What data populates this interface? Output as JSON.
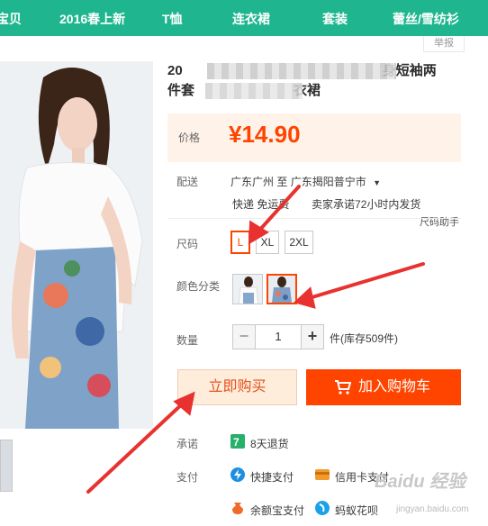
{
  "nav": {
    "items": [
      "宝贝",
      "2016春上新",
      "T恤",
      "连衣裙",
      "套装",
      "蕾丝/雪纺衫"
    ]
  },
  "report": "举报",
  "product": {
    "title_line1_start": "20",
    "title_line1_end": "身短袖两",
    "title_line2_start": "件套",
    "title_line2_end": "衣裙"
  },
  "price": {
    "label": "价格",
    "value": "¥14.90"
  },
  "shipping": {
    "label": "配送",
    "from": "广东广州",
    "to_word": "至",
    "to": "广东揭阳普宁市",
    "express": "快递 免运费",
    "promise": "卖家承诺72小时内发货"
  },
  "size": {
    "label": "尺码",
    "help": "尺码助手",
    "options": [
      "L",
      "XL",
      "2XL"
    ],
    "selected": "L"
  },
  "color": {
    "label": "颜色分类",
    "selected_index": 1
  },
  "quantity": {
    "label": "数量",
    "value": "1",
    "minus": "−",
    "plus": "+",
    "stock": "件(库存509件)"
  },
  "buttons": {
    "buy_now": "立即购买",
    "add_cart": "加入购物车"
  },
  "promise": {
    "label": "承诺",
    "return": "8天退货"
  },
  "payment": {
    "label": "支付",
    "quick": "快捷支付",
    "credit": "信用卡支付",
    "yuebao": "余额宝支付",
    "huabei": "蚂蚁花呗"
  },
  "watermark": {
    "brand": "Baidu 经验",
    "url": "jingyan.baidu.com"
  },
  "colors": {
    "nav_bg": "#1fb68f",
    "accent": "#ff4400",
    "price_bg": "#fff2e8",
    "annotation_arrow": "#e8322f"
  }
}
